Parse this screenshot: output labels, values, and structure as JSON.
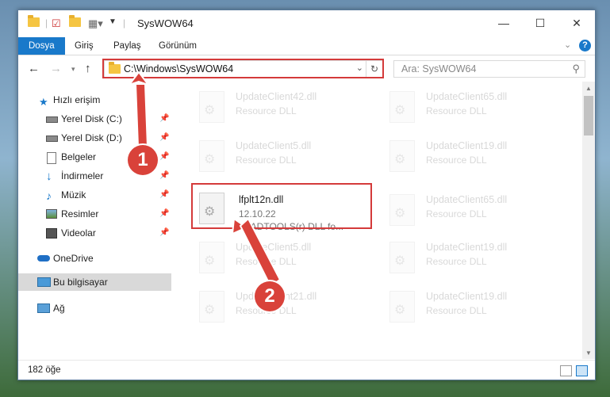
{
  "window": {
    "title": "SysWOW64",
    "controls": {
      "minimize": "—",
      "maximize": "☐",
      "close": "✕"
    }
  },
  "ribbon": {
    "tabs": [
      {
        "label": "Dosya",
        "active": true
      },
      {
        "label": "Giriş"
      },
      {
        "label": "Paylaş"
      },
      {
        "label": "Görünüm"
      }
    ]
  },
  "address": {
    "path": "C:\\Windows\\SysWOW64",
    "search_placeholder": "Ara: SysWOW64"
  },
  "nav": {
    "items": [
      {
        "label": "Hızlı erişim",
        "icon": "star-icon"
      },
      {
        "label": "Yerel Disk (C:)",
        "icon": "drive-icon"
      },
      {
        "label": "Yerel Disk (D:)",
        "icon": "drive-icon"
      },
      {
        "label": "Belgeler",
        "icon": "documents-icon"
      },
      {
        "label": "İndirmeler",
        "icon": "download-icon"
      },
      {
        "label": "Müzik",
        "icon": "music-icon"
      },
      {
        "label": "Resimler",
        "icon": "pictures-icon"
      },
      {
        "label": "Videolar",
        "icon": "videos-icon"
      },
      {
        "label": "OneDrive",
        "icon": "cloud-icon"
      },
      {
        "label": "Bu bilgisayar",
        "icon": "computer-icon",
        "selected": true
      },
      {
        "label": "Ağ",
        "icon": "network-icon"
      }
    ]
  },
  "files": [
    {
      "name": "UpdateClient42.dll",
      "sub1": "Resource DLL",
      "sub2": ""
    },
    {
      "name": "UpdateClient65.dll",
      "sub1": "Resource DLL",
      "sub2": ""
    },
    {
      "name": "UpdateClient5.dll",
      "sub1": "Resource DLL",
      "sub2": ""
    },
    {
      "name": "UpdateClient19.dll",
      "sub1": "Resource DLL",
      "sub2": ""
    },
    {
      "name": "lfplt12n.dll",
      "sub1": "12.10.22",
      "sub2": "LEADTOOLS(r) DLL fo...",
      "highlighted": true
    },
    {
      "name": "UpdateClient65.dll",
      "sub1": "Resource DLL",
      "sub2": ""
    },
    {
      "name": "UpdateClient5.dll",
      "sub1": "Resource DLL",
      "sub2": ""
    },
    {
      "name": "UpdateClient19.dll",
      "sub1": "Resource DLL",
      "sub2": ""
    },
    {
      "name": "UpdateClient21.dll",
      "sub1": "Resource DLL",
      "sub2": ""
    },
    {
      "name": "UpdateClient19.dll",
      "sub1": "Resource DLL",
      "sub2": ""
    }
  ],
  "status": {
    "item_count": "182 öğe"
  },
  "annotations": {
    "step1": "1",
    "step2": "2"
  },
  "colors": {
    "accent": "#1979ca",
    "annotation_red": "#d43a3a"
  }
}
